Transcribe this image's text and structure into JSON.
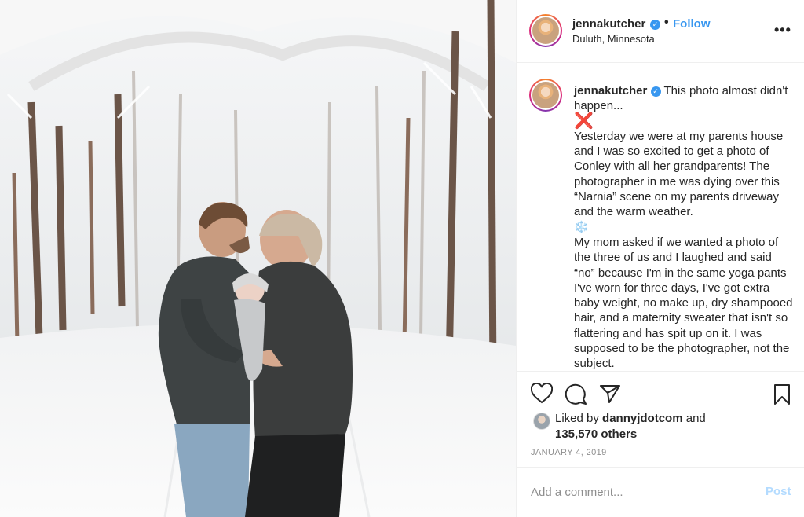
{
  "post": {
    "username": "jennakutcher",
    "verified_icon": "verified-badge-icon",
    "dot": "•",
    "follow_label": "Follow",
    "location": "Duluth, Minnesota",
    "more_icon": "more-options-icon",
    "more_label": "•••"
  },
  "caption": {
    "username": "jennakutcher",
    "lines": [
      "This photo almost didn't happen...",
      "❌",
      "Yesterday we were at my parents house and I was so excited to get a photo of Conley with all her grandparents! The photographer in me was dying over this “Narnia” scene on my parents driveway and the warm weather.",
      "❄️",
      "My mom asked if we wanted a photo of the three of us and I laughed and said “no” because I'm in the same yoga pants I've worn for three days, I've got extra baby weight, no make up, dry shampooed hair, and a maternity sweater that isn't so flattering and has spit up on it. I was supposed to be the photographer, not the subject."
    ]
  },
  "actions": {
    "like_icon": "heart-icon",
    "comment_icon": "comment-icon",
    "share_icon": "share-icon",
    "save_icon": "bookmark-icon"
  },
  "likes": {
    "prefix": "Liked by",
    "user": "dannyjdotcom",
    "joiner": "and",
    "count_text": "135,570 others"
  },
  "date": "JANUARY 4, 2019",
  "comment": {
    "placeholder": "Add a comment...",
    "post_label": "Post"
  },
  "colors": {
    "accent": "#3897f0",
    "post_disabled": "#b3dbff",
    "muted": "#8e8e8e"
  }
}
